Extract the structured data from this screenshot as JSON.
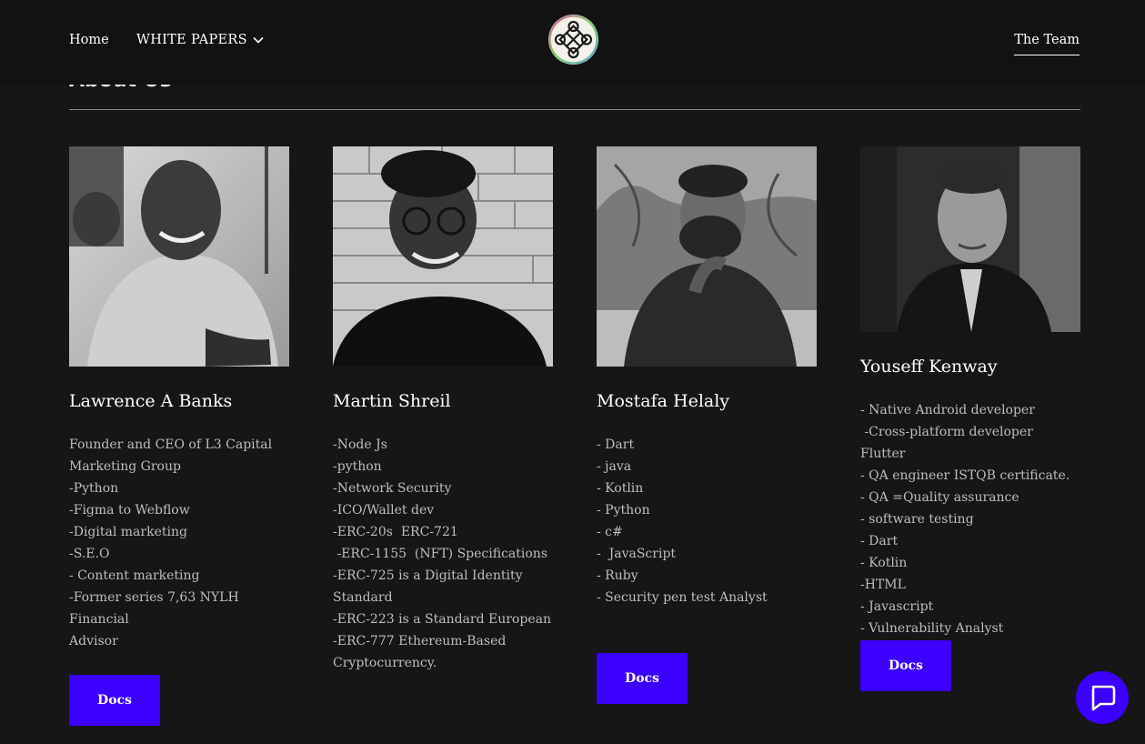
{
  "nav": {
    "home": "Home",
    "white_papers": "WHITE PAPERS",
    "team": "The Team"
  },
  "section": {
    "title": "About Us"
  },
  "team": [
    {
      "name": "Lawrence A Banks",
      "skills": [
        "Founder and CEO of L3 Capital",
        "Marketing Group",
        "-Python",
        "-Figma to Webflow",
        "-Digital marketing",
        "-S.E.O",
        "- Content marketing",
        "-Former series 7,63 NYLH Financial",
        "Advisor"
      ],
      "button": "Docs"
    },
    {
      "name": "Martin Shreil",
      "skills": [
        "-Node Js",
        "-python",
        "-Network Security",
        "-ICO/Wallet dev",
        "-ERC-20s  ERC-721",
        " -ERC-1155  (NFT) Specifications",
        "-ERC-725 is a Digital Identity",
        "Standard",
        "-ERC-223 is a Standard European",
        "-ERC-777 Ethereum-Based",
        "Cryptocurrency."
      ]
    },
    {
      "name": "Mostafa Helaly",
      "skills": [
        "- Dart",
        "- java",
        "- Kotlin",
        "- Python",
        "- c#",
        "-  JavaScript",
        "- Ruby",
        "- Security pen test Analyst"
      ],
      "button": "Docs"
    },
    {
      "name": "Youseff Kenway",
      "skills": [
        "- Native Android developer",
        " -Cross-platform developer Flutter",
        "- QA engineer ISTQB certificate.",
        "- QA =Quality assurance",
        "- software testing",
        "- Dart",
        "- Kotlin",
        "-HTML",
        "- Javascript",
        "- Vulnerability Analyst"
      ],
      "button": "Docs"
    }
  ],
  "icons": {
    "logo": "celtic-knot-logo",
    "dropdown": "chevron-down-icon",
    "chat": "chat-bubble-icon"
  },
  "colors": {
    "background": "#161616",
    "navbar": "#121212",
    "accent": "#3b00ff",
    "text": "#ffffff",
    "muted_text": "#bdbdbd"
  }
}
